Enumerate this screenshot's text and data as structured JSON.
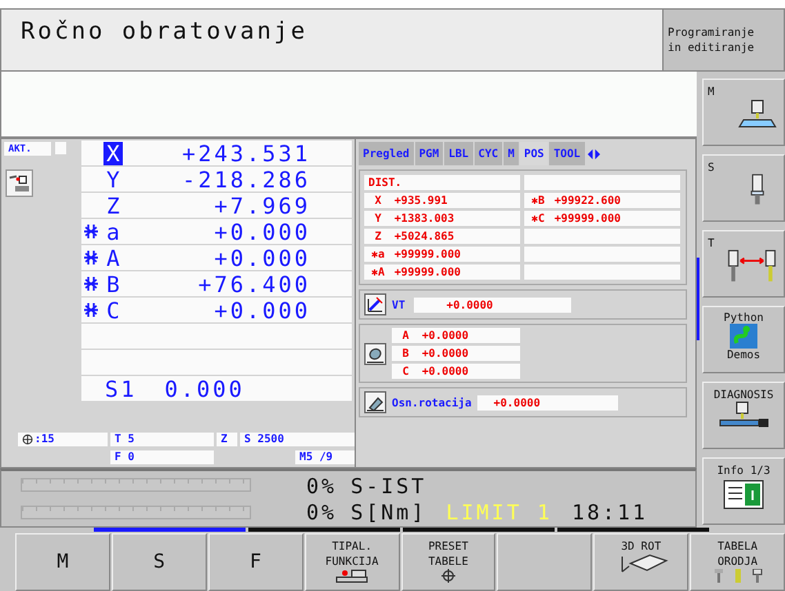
{
  "title": "Ročno obratovanje",
  "mode_key": "Programiranje in editiranje",
  "akt_label": "AKT.",
  "axes": [
    {
      "kind": "axis",
      "label": "X",
      "value": "+243.531",
      "selected": true,
      "clamped": false
    },
    {
      "kind": "axis",
      "label": "Y",
      "value": "-218.286",
      "selected": false,
      "clamped": false
    },
    {
      "kind": "axis",
      "label": "Z",
      "value": "+7.969",
      "selected": false,
      "clamped": false
    },
    {
      "kind": "axis",
      "label": "a",
      "value": "+0.000",
      "selected": false,
      "clamped": true
    },
    {
      "kind": "axis",
      "label": "A",
      "value": "+0.000",
      "selected": false,
      "clamped": true
    },
    {
      "kind": "axis",
      "label": "B",
      "value": "+76.400",
      "selected": false,
      "clamped": true
    },
    {
      "kind": "axis",
      "label": "C",
      "value": "+0.000",
      "selected": false,
      "clamped": true
    },
    {
      "kind": "empty"
    },
    {
      "kind": "empty"
    },
    {
      "kind": "spindle",
      "label": "S1",
      "value": "0.000"
    }
  ],
  "tool_status": {
    "override": ":15",
    "tool": "T 5",
    "axis": "Z",
    "spindle": "S 2500",
    "feed": "F 0",
    "m": "M5 /9"
  },
  "tabs": [
    {
      "label": "Pregled",
      "selected": false
    },
    {
      "label": "PGM",
      "selected": false
    },
    {
      "label": "LBL",
      "selected": false
    },
    {
      "label": "CYC",
      "selected": false
    },
    {
      "label": "M",
      "selected": false
    },
    {
      "label": "POS",
      "selected": true
    },
    {
      "label": "TOOL",
      "selected": false
    }
  ],
  "dist": {
    "title": "DIST.",
    "left": [
      {
        "label": "X",
        "value": "+935.991"
      },
      {
        "label": "Y",
        "value": "+1383.003"
      },
      {
        "label": "Z",
        "value": "+5024.865"
      },
      {
        "label": "✱a",
        "value": "+99999.000"
      },
      {
        "label": "✱A",
        "value": "+99999.000"
      }
    ],
    "right": [
      {
        "label": "✱B",
        "value": "+99922.600"
      },
      {
        "label": "✱C",
        "value": "+99999.000"
      }
    ]
  },
  "vt": {
    "label": "VT",
    "value": "+0.0000"
  },
  "rotations": [
    {
      "label": "A",
      "value": "+0.0000"
    },
    {
      "label": "B",
      "value": "+0.0000"
    },
    {
      "label": "C",
      "value": "+0.0000"
    }
  ],
  "basic_rotation": {
    "label": "Osn.rotacija",
    "value": "+0.0000"
  },
  "load": [
    {
      "level": 0,
      "percent": "0%",
      "label": "S-IST"
    },
    {
      "level": 0,
      "percent": "0%",
      "label": "S[Nm]"
    }
  ],
  "limit": "LIMIT 1",
  "time": "18:11",
  "side_keys": [
    {
      "kind": "machine",
      "label": "M"
    },
    {
      "kind": "spindle",
      "label": "S"
    },
    {
      "kind": "tool-change",
      "label": "T"
    },
    {
      "kind": "python",
      "label": "Python",
      "label2": "Demos"
    },
    {
      "kind": "diagnosis",
      "label": "DIAGNOSIS"
    },
    {
      "kind": "info",
      "label": "Info 1/3"
    }
  ],
  "soft_pages": [
    {
      "selected": true
    },
    {
      "selected": false
    },
    {
      "selected": false
    },
    {
      "selected": false
    }
  ],
  "soft_keys": [
    {
      "kind": "text",
      "label": "M"
    },
    {
      "kind": "text",
      "label": "S"
    },
    {
      "kind": "text",
      "label": "F"
    },
    {
      "kind": "probe",
      "label": "TIPAL. FUNKCIJA"
    },
    {
      "kind": "preset",
      "label": "PRESET TABELE"
    },
    {
      "kind": "blank"
    },
    {
      "kind": "rot3d",
      "label": "3D ROT"
    },
    {
      "kind": "tools",
      "label": "TABELA ORODJA"
    }
  ]
}
